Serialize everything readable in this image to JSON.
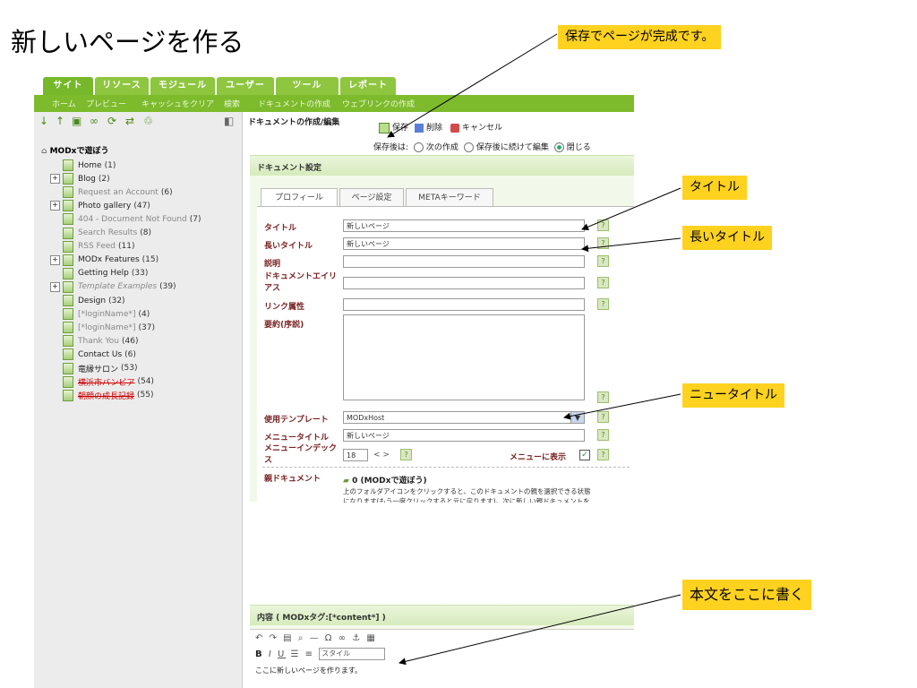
{
  "page_title": "新しいページを作る",
  "callouts": {
    "save": "保存でページが完成です。",
    "title": "タイトル",
    "long_title": "長いタイトル",
    "new_title": "ニュータイトル",
    "body": "本文をここに書く"
  },
  "main_tabs": [
    "サイト",
    "リソース",
    "モジュール",
    "ユーザー",
    "ツール",
    "レポート"
  ],
  "sub_nav": [
    "ホーム",
    "プレビュー",
    "キャッシュをクリア",
    "検索",
    "ドキュメントの作成",
    "ウェブリンクの作成"
  ],
  "tree": {
    "root": "MODxで遊ぼう",
    "items": [
      {
        "label": "Home",
        "count": "(1)",
        "style": "normal",
        "expander": false
      },
      {
        "label": "Blog",
        "count": "(2)",
        "style": "normal",
        "expander": true
      },
      {
        "label": "Request an Account",
        "count": "(6)",
        "style": "grey",
        "expander": false
      },
      {
        "label": "Photo gallery",
        "count": "(47)",
        "style": "normal",
        "expander": true
      },
      {
        "label": "404 - Document Not Found",
        "count": "(7)",
        "style": "grey",
        "expander": false
      },
      {
        "label": "Search Results",
        "count": "(8)",
        "style": "grey",
        "expander": false
      },
      {
        "label": "RSS Feed",
        "count": "(11)",
        "style": "grey",
        "expander": false
      },
      {
        "label": "MODx Features",
        "count": "(15)",
        "style": "normal",
        "expander": true
      },
      {
        "label": "Getting Help",
        "count": "(33)",
        "style": "normal",
        "expander": false
      },
      {
        "label": "Template Examples",
        "count": "(39)",
        "style": "italic",
        "expander": true
      },
      {
        "label": "Design",
        "count": "(32)",
        "style": "normal",
        "expander": false
      },
      {
        "label": "[*loginName*]",
        "count": "(4)",
        "style": "grey",
        "expander": false
      },
      {
        "label": "[*loginName*]",
        "count": "(37)",
        "style": "grey",
        "expander": false
      },
      {
        "label": "Thank You",
        "count": "(46)",
        "style": "grey",
        "expander": false
      },
      {
        "label": "Contact Us",
        "count": "(6)",
        "style": "normal",
        "expander": false
      },
      {
        "label": "竜縁サロン",
        "count": "(53)",
        "style": "normal",
        "expander": false
      },
      {
        "label": "横浜市バンビア",
        "count": "(54)",
        "style": "strike",
        "expander": false
      },
      {
        "label": "朝顔の成長記録",
        "count": "(55)",
        "style": "strike",
        "expander": false
      }
    ]
  },
  "doc_header": "ドキュメントの作成/編集",
  "actions": {
    "save": "保存",
    "delete": "削除",
    "cancel": "キャンセル"
  },
  "after_save": {
    "label": "保存後は:",
    "options": [
      "次の作成",
      "保存後に続けて編集",
      "閉じる"
    ],
    "selected": "閉じる"
  },
  "doc_settings_title": "ドキュメント設定",
  "form_tabs": [
    "プロフィール",
    "ページ設定",
    "METAキーワード"
  ],
  "fields": {
    "title_label": "タイトル",
    "title_value": "新しいページ",
    "longtitle_label": "長いタイトル",
    "longtitle_value": "新しいページ",
    "desc_label": "説明",
    "alias_label": "ドキュメントエイリアス",
    "link_label": "リンク属性",
    "summary_label": "要約(序説)",
    "template_label": "使用テンプレート",
    "template_value": "MODxHost",
    "menutitle_label": "メニュータイトル",
    "menutitle_value": "新しいページ",
    "menuindex_label": "メニューインデックス",
    "menuindex_value": "18",
    "menuindex_arrows": "< >",
    "showinmenu_label": "メニューに表示",
    "parent_label": "親ドキュメント",
    "parent_value": "0 (MODxで遊ぼう)",
    "parent_help": "上のフォルダアイコンをクリックすると、このドキュメントの親を選択できる状態になります(もう一度クリックすると元に戻ります)。次に新しい親ドキュメントをツリー内でクリックしてください。"
  },
  "content_section": {
    "title": "内容 ( MODxタグ:[*content*] )",
    "style_select": "スタイル",
    "body_text": "ここに新しいページを作ります。"
  },
  "colors": {
    "accent": "#7dbb2c",
    "callout": "#ffd21f",
    "label": "#7a2222"
  }
}
